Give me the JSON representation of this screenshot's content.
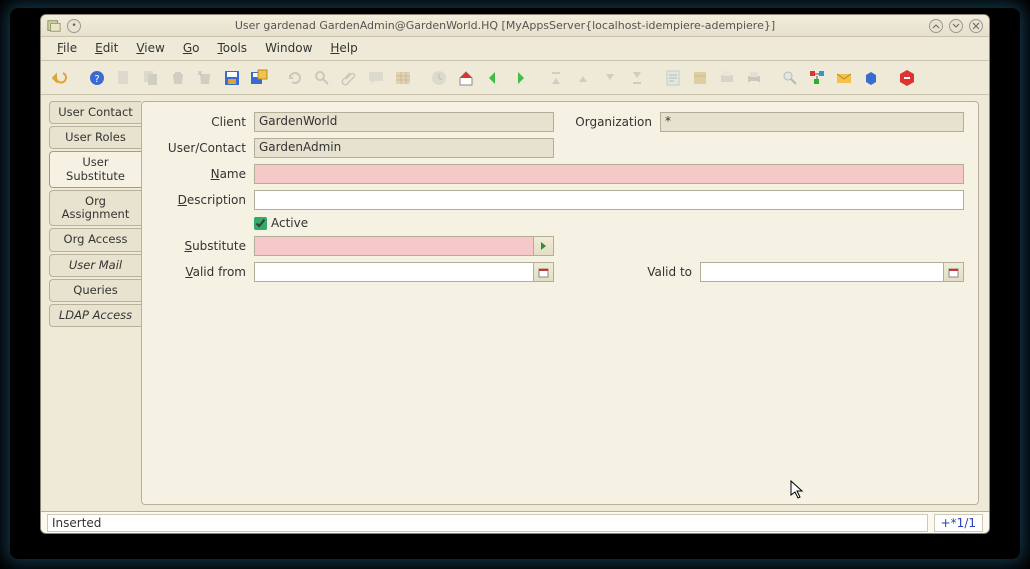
{
  "window": {
    "title": "User  gardenad  GardenAdmin@GardenWorld.HQ [MyAppsServer{localhost-idempiere-adempiere}]"
  },
  "menu": {
    "file": "File",
    "edit": "Edit",
    "view": "View",
    "go": "Go",
    "tools": "Tools",
    "window": "Window",
    "help": "Help"
  },
  "tabs": {
    "user_contact": "User Contact",
    "user_roles": "User Roles",
    "user_substitute": "User Substitute",
    "org_assignment": "Org Assignment",
    "org_access": "Org Access",
    "user_mail": "User Mail",
    "queries": "Queries",
    "ldap_access": "LDAP Access"
  },
  "labels": {
    "client": "Client",
    "organization": "Organization",
    "user_contact": "User/Contact",
    "name": "Name",
    "description": "Description",
    "active": "Active",
    "substitute": "Substitute",
    "valid_from": "Valid from",
    "valid_to": "Valid to"
  },
  "values": {
    "client": "GardenWorld",
    "organization": "*",
    "user_contact": "GardenAdmin",
    "name": "",
    "description": "",
    "active_checked": true,
    "substitute": "",
    "valid_from": "",
    "valid_to": ""
  },
  "status": {
    "left": "Inserted",
    "right": "+*1/1"
  }
}
